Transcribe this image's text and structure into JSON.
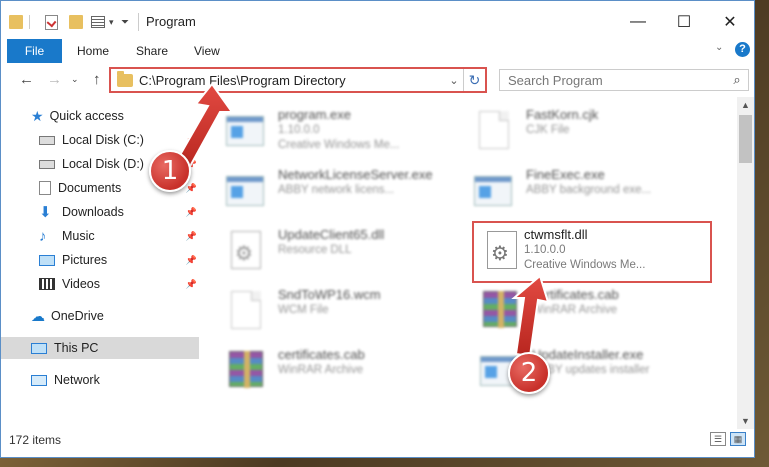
{
  "window": {
    "title": "Program",
    "controls": {
      "minimize": "—",
      "maximize": "☐",
      "close": "✕"
    }
  },
  "ribbon": {
    "file_tab": "File",
    "tabs": [
      "Home",
      "Share",
      "View"
    ],
    "help": "?"
  },
  "address_bar": {
    "path": "C:\\Program Files\\Program Directory",
    "refresh_icon": "↻"
  },
  "search": {
    "placeholder": "Search Program",
    "icon": "⌕"
  },
  "sidebar": {
    "items": [
      {
        "label": "Quick access",
        "icon": "star-icon",
        "pinned": false
      },
      {
        "label": "Local Disk (C:)",
        "icon": "drive-icon",
        "pinned": true
      },
      {
        "label": "Local Disk (D:)",
        "icon": "drive-icon",
        "pinned": true
      },
      {
        "label": "Documents",
        "icon": "documents-icon",
        "pinned": true
      },
      {
        "label": "Downloads",
        "icon": "download-icon",
        "pinned": true
      },
      {
        "label": "Music",
        "icon": "music-icon",
        "pinned": true
      },
      {
        "label": "Pictures",
        "icon": "pictures-icon",
        "pinned": true
      },
      {
        "label": "Videos",
        "icon": "videos-icon",
        "pinned": true
      },
      {
        "label": "OneDrive",
        "icon": "cloud-icon",
        "pinned": false
      },
      {
        "label": "This PC",
        "icon": "computer-icon",
        "pinned": false
      },
      {
        "label": "Network",
        "icon": "network-icon",
        "pinned": false
      }
    ]
  },
  "files": [
    {
      "name": "program.exe",
      "line2": "1.10.0.0",
      "line3": "Creative Windows Me...",
      "icon": "exe-icon"
    },
    {
      "name": "FastKorn.cjk",
      "line2": "CJK File",
      "line3": "",
      "icon": "document-icon"
    },
    {
      "name": "NetworkLicenseServer.exe",
      "line2": "ABBY network licens...",
      "line3": "",
      "icon": "exe-icon"
    },
    {
      "name": "FineExec.exe",
      "line2": "ABBY background exe...",
      "line3": "",
      "icon": "exe-icon"
    },
    {
      "name": "UpdateClient65.dll",
      "line2": "Resource DLL",
      "line3": "",
      "icon": "dll-icon"
    },
    {
      "name": "ctwmsflt.dll",
      "line2": "1.10.0.0",
      "line3": "Creative Windows Me...",
      "icon": "dll-icon"
    },
    {
      "name": "SndToWP16.wcm",
      "line2": "WCM File",
      "line3": "",
      "icon": "document-icon"
    },
    {
      "name": "certificates.cab",
      "line2": "WinRAR Archive",
      "line3": "",
      "icon": "archive-icon"
    },
    {
      "name": "certificates.cab",
      "line2": "WinRAR Archive",
      "line3": "",
      "icon": "archive-icon"
    },
    {
      "name": "UpdateInstaller.exe",
      "line2": "ABBY updates installer",
      "line3": "",
      "icon": "exe-icon"
    }
  ],
  "status": {
    "item_count": "172 items"
  },
  "callouts": [
    {
      "number": "1",
      "color": "#c8302a"
    },
    {
      "number": "2",
      "color": "#c8302a"
    }
  ],
  "colors": {
    "accent": "#1979ca",
    "highlight": "#d9534f"
  }
}
